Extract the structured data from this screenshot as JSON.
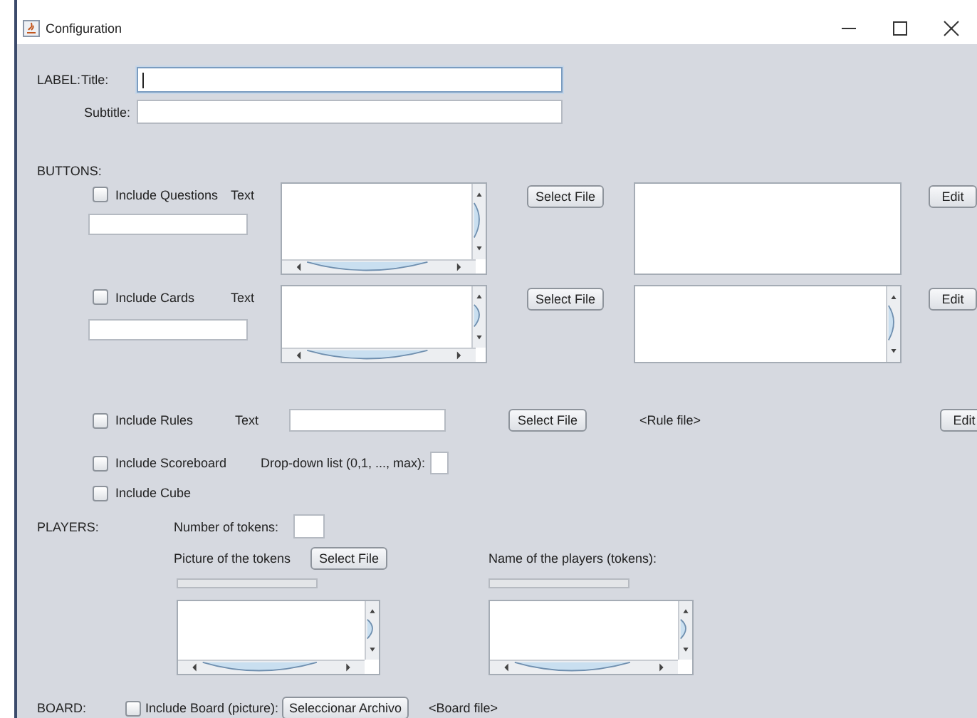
{
  "window": {
    "title": "Configuration"
  },
  "label_section": {
    "heading": "LABEL:",
    "fields": [
      {
        "label": "Title:",
        "focused": true
      },
      {
        "label": "Subtitle:",
        "focused": false
      }
    ]
  },
  "buttons_section": {
    "heading": "BUTTONS:",
    "items": [
      {
        "kind": "textarea",
        "checkbox": {
          "label": "Include Questions",
          "checked": false
        },
        "text_label": "Text",
        "select_button": "Select File",
        "edit_button": "Edit",
        "preview_scrollable": false
      },
      {
        "kind": "textarea",
        "checkbox": {
          "label": "Include Cards",
          "checked": false
        },
        "text_label": "Text",
        "select_button": "Select File",
        "edit_button": "Edit",
        "preview_scrollable": true
      },
      {
        "kind": "line",
        "checkbox": {
          "label": "Include Rules",
          "checked": false
        },
        "text_label": "Text",
        "select_button": "Select File",
        "file_label": "<Rule file>",
        "edit_button": "Edit"
      },
      {
        "kind": "dropdown",
        "checkbox": {
          "label": "Include Scoreboard",
          "checked": false
        },
        "dropdown_label": "Drop-down list (0,1, ..., max):"
      },
      {
        "kind": "plain",
        "checkbox": {
          "label": "Include Cube",
          "checked": false
        }
      }
    ]
  },
  "players": {
    "heading": "PLAYERS:",
    "tokens_label": "Number of tokens:",
    "picture_label": "Picture of the tokens",
    "select_button": "Select File",
    "names_label": "Name of the players (tokens):"
  },
  "board": {
    "heading": "BOARD:",
    "checkbox": {
      "label": "Include Board (picture):",
      "checked": false
    },
    "button": "Seleccionar Archivo",
    "file_label": "<Board file>"
  }
}
